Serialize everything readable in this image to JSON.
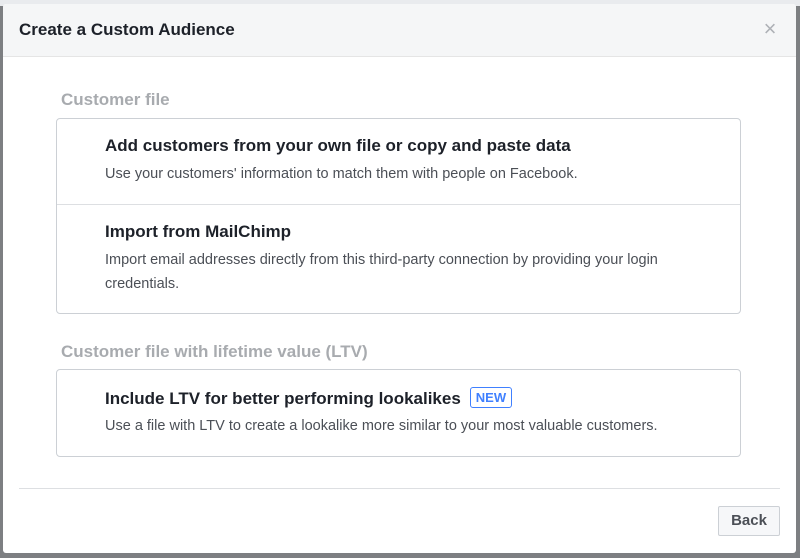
{
  "dialog": {
    "title": "Create a Custom Audience",
    "close_icon": "close-icon",
    "close_glyph": "×"
  },
  "sections": [
    {
      "title": "Customer file",
      "options": [
        {
          "title": "Add customers from your own file or copy and paste data",
          "description": "Use your customers' information to match them with people on Facebook."
        },
        {
          "title": "Import from MailChimp",
          "description": "Import email addresses directly from this third-party connection by providing your login credentials."
        }
      ]
    },
    {
      "title": "Customer file with lifetime value (LTV)",
      "options": [
        {
          "title": "Include LTV for better performing lookalikes",
          "badge": "NEW",
          "description": "Use a file with LTV to create a lookalike more similar to your most valuable customers."
        }
      ]
    }
  ],
  "footer": {
    "back_label": "Back"
  },
  "colors": {
    "header_bg": "#f5f6f7",
    "section_title": "#a8abaf",
    "badge_accent": "#4080ff",
    "border": "#ccd0d5"
  }
}
